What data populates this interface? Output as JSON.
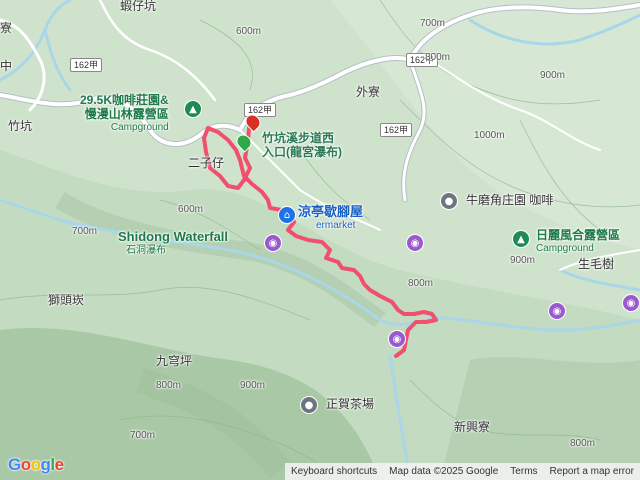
{
  "places": {
    "xiazai_keng": "蝦仔坑",
    "zhukeng": "竹坑",
    "waiqiao": "外寮",
    "erzi": "二子仔",
    "shitou_peng": "獅頭崁",
    "jiuqiong": "九穹坪",
    "xinxing": "新興寮",
    "zhuangping": "生毛樹",
    "top_left": "寮",
    "left_edge": "中"
  },
  "roads": {
    "r162_1": "162甲",
    "r162_2": "162甲",
    "r162_3": "162甲",
    "r162_4": "162甲"
  },
  "pois": {
    "camp1_name": "29.5K咖啡莊園&",
    "camp1_name2": "慢漫山林露營區",
    "camp1_type": "Campground",
    "trailhead": "竹坑溪步道西",
    "trailhead2": "入口(龍宮瀑布)",
    "liangting": "涼亭歇腳屋",
    "liangting_sub": "ermarket",
    "waterfall_en": "Shidong Waterfall",
    "waterfall_zh": "石洞瀑布",
    "cafe": "牛磨角庄園 咖啡",
    "camp2_name": "日麗風合露營區",
    "camp2_type": "Campground",
    "tea": "正賀茶場"
  },
  "contours": {
    "c700a": "700m",
    "c800a": "800m",
    "c900a": "900m",
    "c600a": "600m",
    "c600b": "600m",
    "c700b": "700m",
    "c800b": "800m",
    "c900b": "900m",
    "c1000": "1000m",
    "c700c": "700m",
    "c800c": "800m",
    "c900c": "900m",
    "c800d": "800m"
  },
  "footer": {
    "shortcuts": "Keyboard shortcuts",
    "mapdata": "Map data ©2025 Google",
    "terms": "Terms",
    "report": "Report a map error"
  },
  "icons": {
    "camp": "campground-icon",
    "photo": "camera-icon",
    "gray": "place-icon",
    "transit": "transit-icon",
    "start": "start-flag-icon",
    "end": "end-pin-icon"
  },
  "colors": {
    "route": "#f0506e",
    "road": "#ffffff",
    "water": "#a9d6e8",
    "terrain": "#cfe3cc"
  }
}
